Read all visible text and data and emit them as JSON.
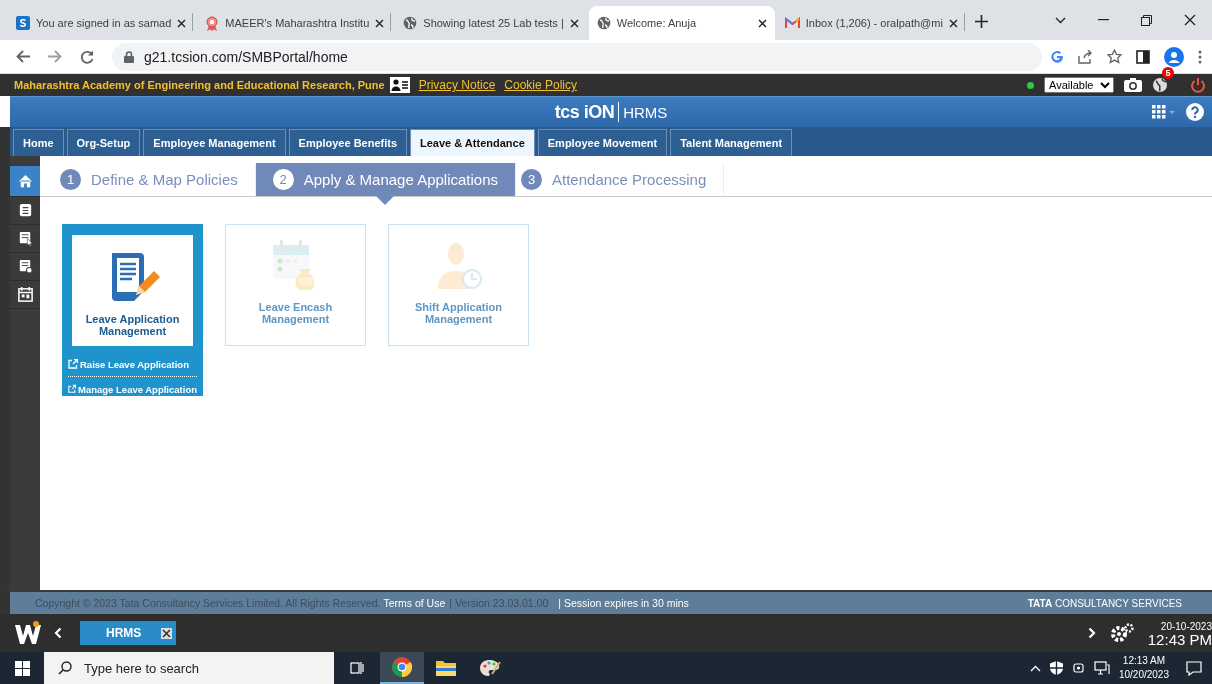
{
  "browser": {
    "tabs": [
      {
        "title": "You are signed in as samad",
        "kind": "square",
        "selected": false
      },
      {
        "title": "MAEER's Maharashtra Institu",
        "kind": "ribbon",
        "selected": false
      },
      {
        "title": "Showing latest 25 Lab tests |",
        "kind": "globe",
        "selected": false
      },
      {
        "title": "Welcome: Anuja",
        "kind": "globe",
        "selected": true
      },
      {
        "title": "Inbox (1,206) - oralpath@mi",
        "kind": "mail",
        "selected": false
      }
    ],
    "url": "g21.tcsion.com/SMBPortal/home"
  },
  "header": {
    "org": "Maharashtra Academy of Engineering and Educational Research, Pune",
    "links": [
      "Privacy Notice",
      "Cookie Policy"
    ],
    "status": "Available",
    "notification_count": "5"
  },
  "brand": {
    "logo": "tcs iON",
    "product": "HRMS"
  },
  "modules": [
    {
      "label": "Home",
      "selected": false
    },
    {
      "label": "Org-Setup",
      "selected": false
    },
    {
      "label": "Employee Management",
      "selected": false
    },
    {
      "label": "Employee Benefits",
      "selected": false
    },
    {
      "label": "Leave & Attendance",
      "selected": true
    },
    {
      "label": "Employee Movement",
      "selected": false
    },
    {
      "label": "Talent Management",
      "selected": false
    }
  ],
  "sidebar": {
    "items": [
      {
        "kind": "home",
        "selected": true
      },
      {
        "kind": "list",
        "selected": false
      },
      {
        "kind": "pointer",
        "selected": false
      },
      {
        "kind": "gear",
        "selected": false
      },
      {
        "kind": "calendar",
        "selected": false
      }
    ]
  },
  "steps": [
    {
      "number": "1",
      "label": "Define & Map Policies",
      "selected": false
    },
    {
      "number": "2",
      "label": "Apply & Manage Applications",
      "selected": true
    },
    {
      "number": "3",
      "label": "Attendance Processing",
      "selected": false
    }
  ],
  "tiles": [
    {
      "title": "Leave Application Management",
      "kind": "document",
      "selected": true,
      "disabled": false,
      "links": [
        "Raise Leave Application",
        "Manage Leave Application"
      ]
    },
    {
      "title": "Leave Encash Management",
      "kind": "encash",
      "selected": false,
      "disabled": true
    },
    {
      "title": "Shift Application Management",
      "kind": "shift",
      "selected": false,
      "disabled": true
    }
  ],
  "footer": {
    "copyright": "Copyright © 2023 Tata Consultancy Services Limited. All Rights Reserved.",
    "terms": "Terms of Use",
    "version": "| Version 23.03.01.00",
    "session": "| Session expires in 30 mins",
    "company": "**TATA** CONSULTANCY SERVICES"
  },
  "app_bar": {
    "tabs": [
      {
        "label": "HRMS",
        "selected": true
      }
    ],
    "date": "20-10-2023",
    "time": "12:43 PM"
  },
  "taskbar": {
    "search_placeholder": "Type here to search",
    "apps": [
      {
        "kind": "chrome",
        "selected": true
      },
      {
        "kind": "folder",
        "selected": false
      },
      {
        "kind": "paint",
        "selected": false
      }
    ],
    "time": "12:13 AM",
    "date": "10/20/2023"
  }
}
